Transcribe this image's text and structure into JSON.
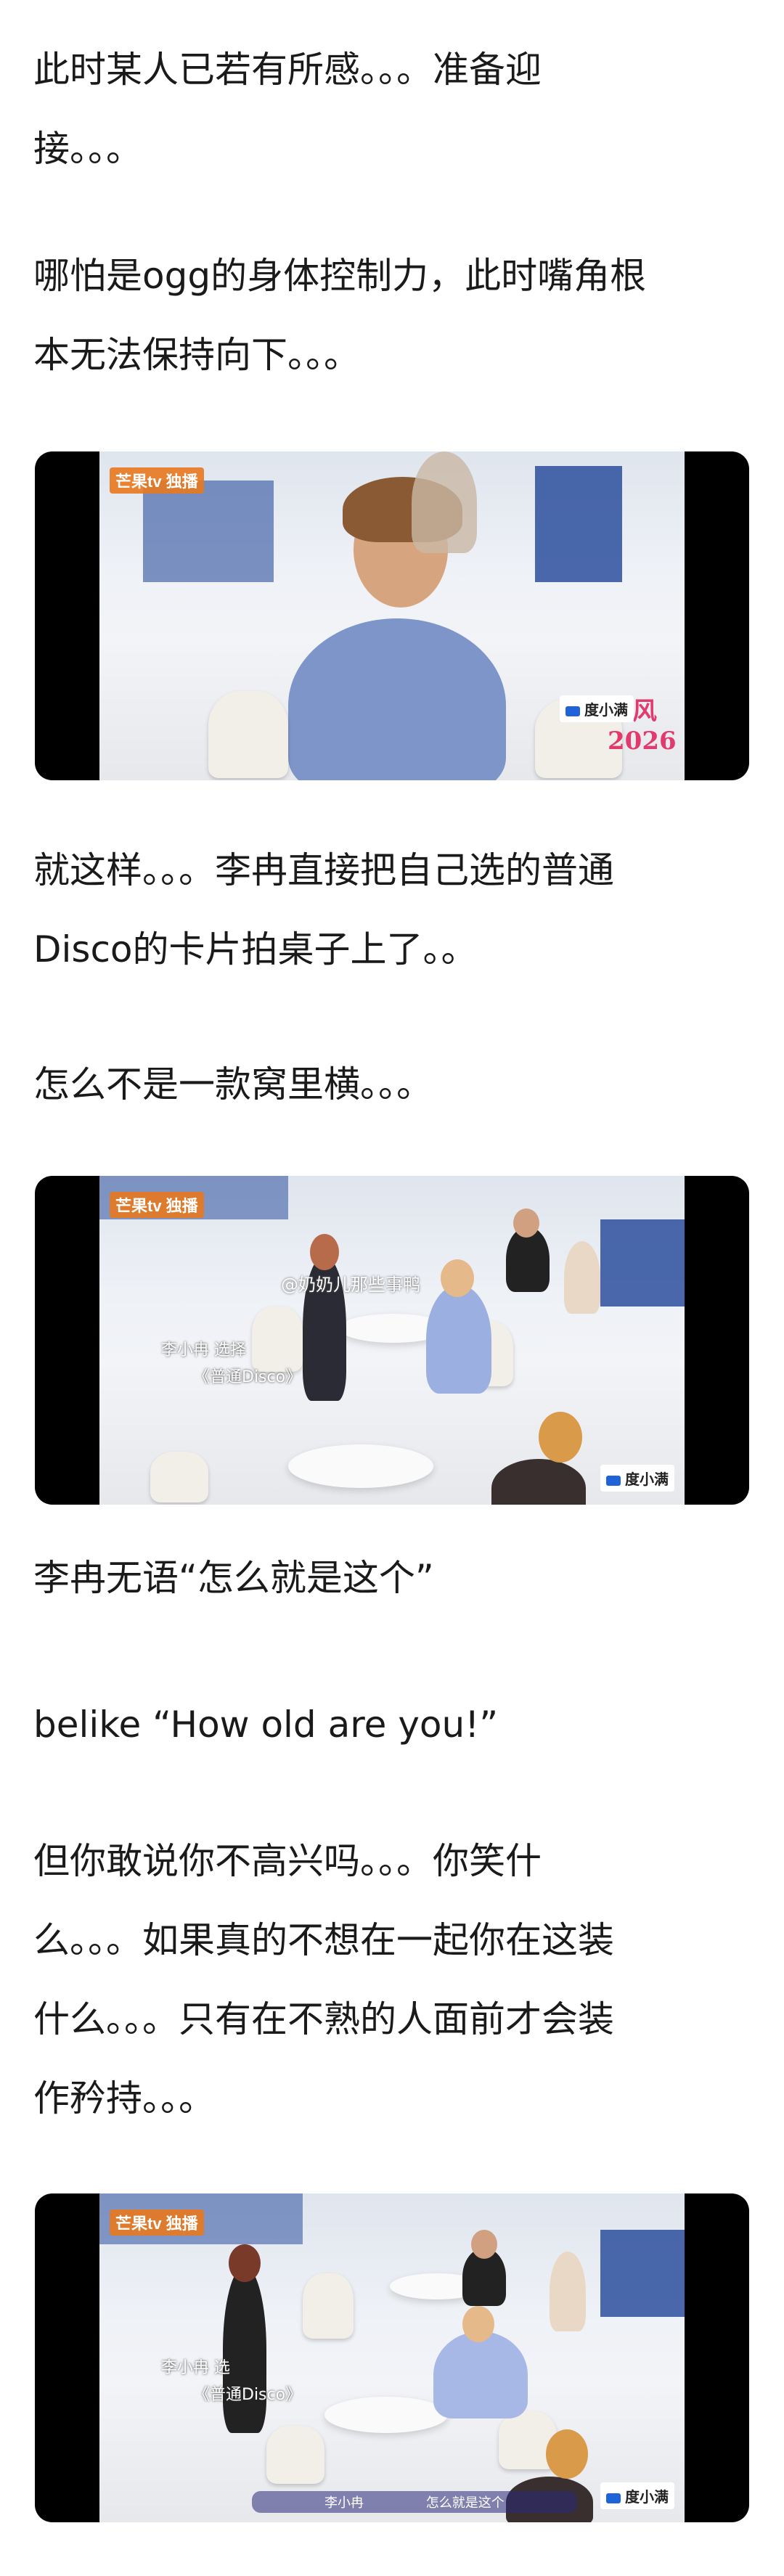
{
  "paragraphs": [
    "此时某人已若有所感。。。准备迎\n接。。。",
    "哪怕是ogg的身体控制力，此时嘴角根\n本无法保持向下。。。",
    "就这样。。。李冉直接把自己选的普通\nDisco的卡片拍桌子上了。。",
    "怎么不是一款窝里横。。。",
    "李冉无语“怎么就是这个”",
    "belike “How old are you!”",
    "但你敢说你不高兴吗。。。你笑什\n么。。。如果真的不想在一起你在这装\n什么。。。只有在不熟的人面前才会装\n作矜持。。。"
  ],
  "images": {
    "img1": {
      "watermark": "芒果tv 独播",
      "badge": "度小满",
      "deco_text": "乘风 2026"
    },
    "img2": {
      "watermark": "芒果tv 独播",
      "weibo_handle": "@奶奶儿那些事鸭",
      "caption_line1": "李小冉 选择",
      "caption_line2": "《普通Disco》",
      "badge": "度小满"
    },
    "img3": {
      "watermark": "芒果tv 独播",
      "caption_line1": "李小冉 选",
      "caption_line2": "《普通Disco》",
      "subtitle_speaker": "李小冉",
      "subtitle_text": "怎么就是这个",
      "badge": "度小满"
    }
  },
  "colors": {
    "text": "#1a1a1a",
    "background": "#ffffff",
    "photo_letterbox": "#000000"
  }
}
